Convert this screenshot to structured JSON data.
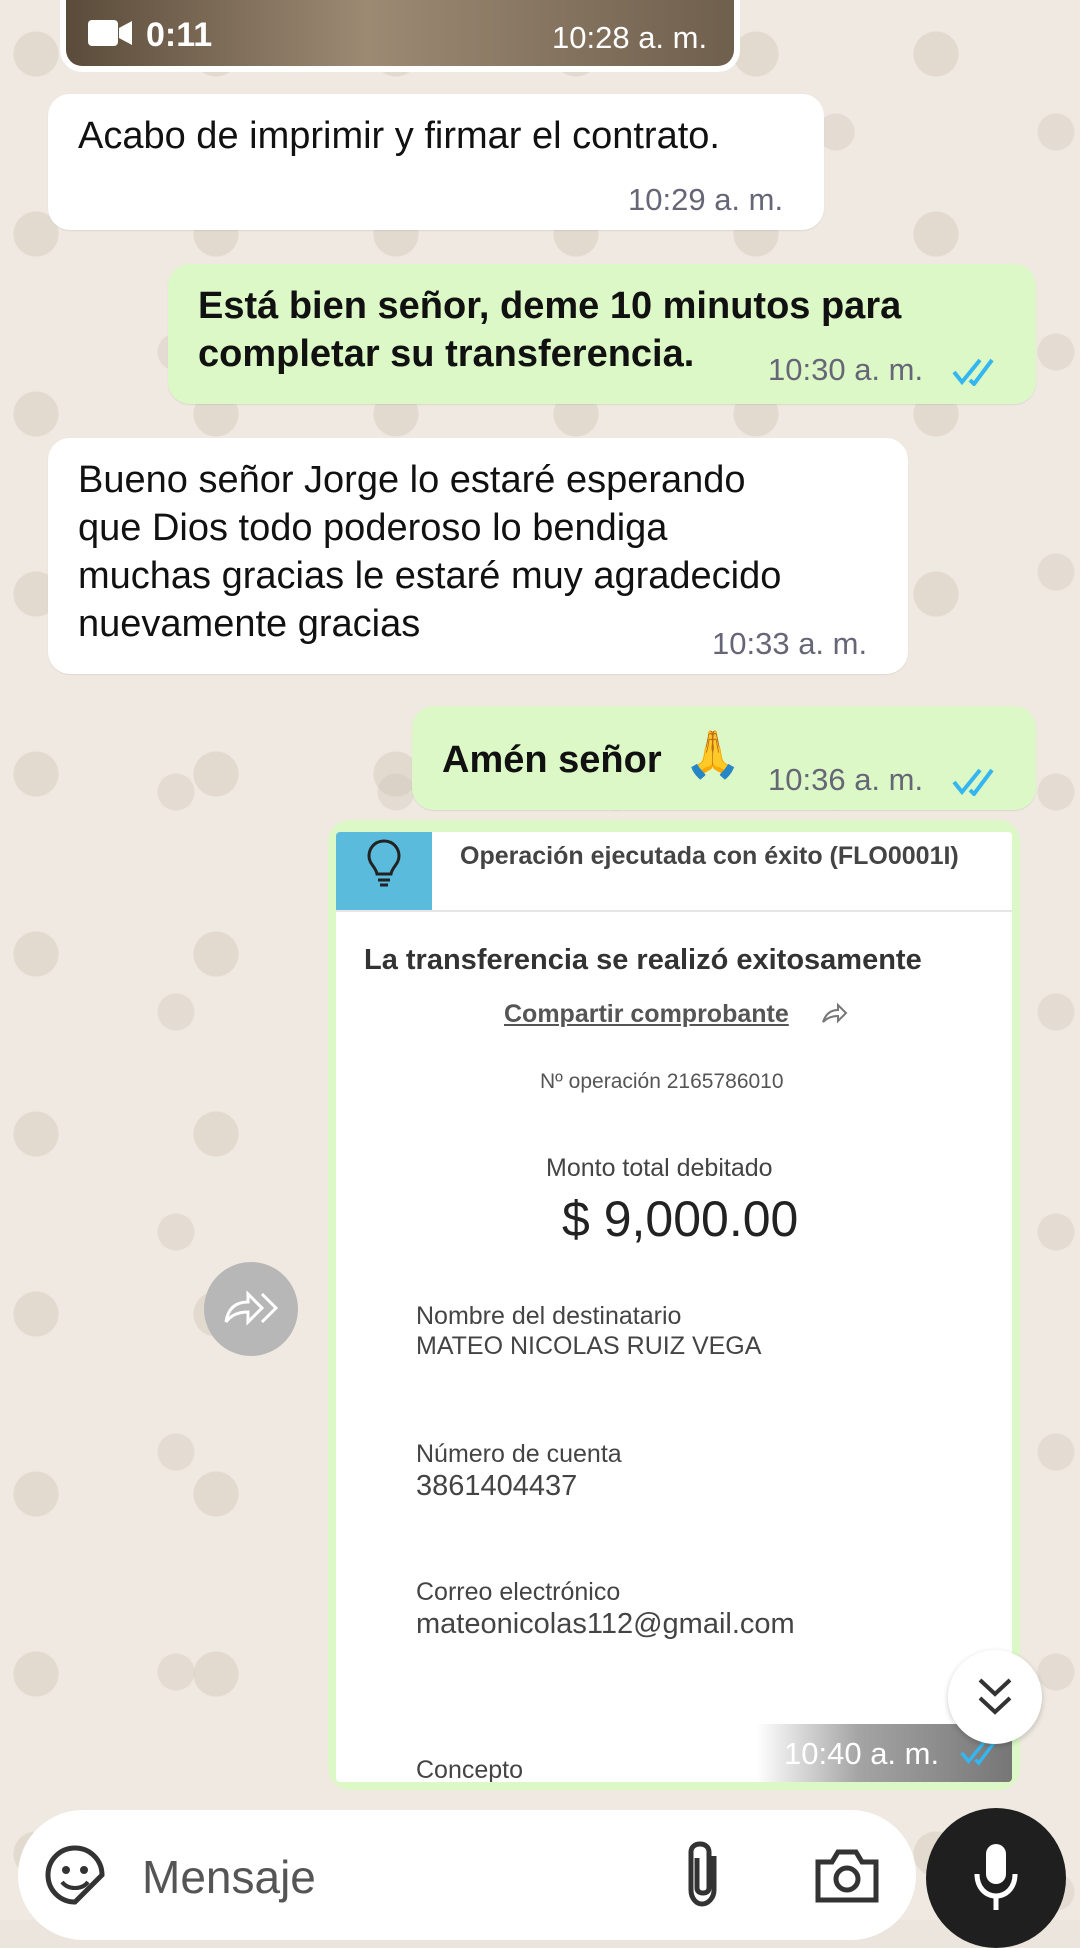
{
  "video": {
    "duration": "0:11",
    "time": "10:28 a. m."
  },
  "messages": [
    {
      "text": "Acabo de imprimir y firmar el contrato.",
      "time": "10:29 a. m."
    },
    {
      "line1": "Está bien señor, deme 10 minutos para",
      "line2": "completar su transferencia.",
      "time": "10:30 a. m."
    },
    {
      "line1": "Bueno señor Jorge lo estaré esperando",
      "line2": "que Dios todo poderoso lo bendiga",
      "line3": "muchas gracias le estaré muy agradecido",
      "line4": "nuevamente gracias",
      "time": "10:33 a. m."
    },
    {
      "text": "Amén señor",
      "emoji": "🙏",
      "time": "10:36 a. m."
    }
  ],
  "receipt": {
    "header": "Operación ejecutada con éxito (FLO0001I)",
    "title": "La transferencia se realizó exitosamente",
    "share_link": "Compartir comprobante",
    "operation": "Nº operación 2165786010",
    "amount_label": "Monto total debitado",
    "amount": "$ 9,000.00",
    "recipient_label": "Nombre del destinatario",
    "recipient": "MATEO NICOLAS RUIZ VEGA",
    "account_label": "Número de cuenta",
    "account": "3861404437",
    "email_label": "Correo electrónico",
    "email": "mateonicolas112@gmail.com",
    "concept_label": "Concepto",
    "time": "10:40 a. m."
  },
  "input": {
    "placeholder": "Mensaje"
  },
  "colors": {
    "incoming": "#ffffff",
    "outgoing": "#dcf8c6",
    "read_ticks": "#34b7f1",
    "receipt_icon_bg": "#5bbbdc"
  },
  "icons": [
    "video-icon",
    "double-check-icon",
    "lightbulb-icon",
    "share-icon",
    "forward-icon",
    "scroll-down-icon",
    "sticker-icon",
    "attach-icon",
    "camera-icon",
    "mic-icon"
  ]
}
